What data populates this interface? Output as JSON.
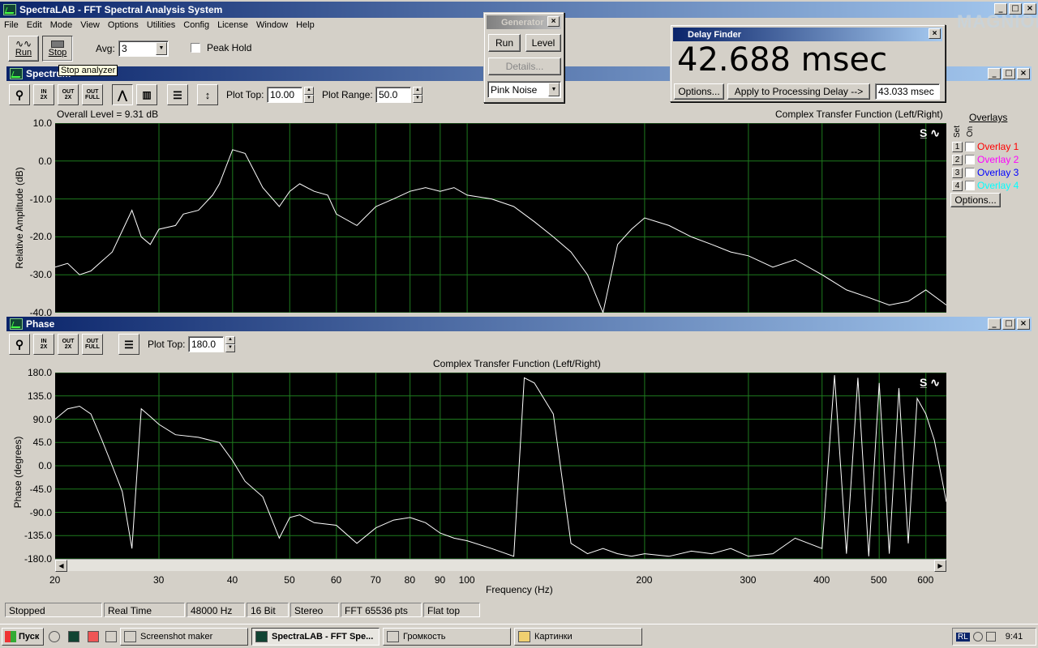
{
  "app": {
    "title": "SpectraLAB - FFT Spectral Analysis System",
    "menu": [
      "File",
      "Edit",
      "Mode",
      "View",
      "Options",
      "Utilities",
      "Config",
      "License",
      "Window",
      "Help"
    ]
  },
  "toolbar": {
    "run_label": "Run",
    "stop_label": "Stop",
    "avg_label": "Avg:",
    "avg_value": "3",
    "peak_hold_label": "Peak Hold",
    "tooltip": "Stop analyzer"
  },
  "spectrum": {
    "title": "Spectrum",
    "plot_top_label": "Plot Top:",
    "plot_top_value": "10.00",
    "plot_range_label": "Plot Range:",
    "plot_range_value": "50.0",
    "overall_level": "Overall Level = 9.31 dB",
    "chart_title": "Complex Transfer Function (Left/Right)",
    "ylabel": "Relative Amplitude (dB)",
    "yticks": [
      "10.0",
      "0.0",
      "-10.0",
      "-20.0",
      "-30.0",
      "-40.0"
    ]
  },
  "overlays": {
    "header": "Overlays",
    "set_label": "Set",
    "on_label": "On",
    "items": [
      {
        "num": "1",
        "label": "Overlay 1",
        "color": "#ff0000"
      },
      {
        "num": "2",
        "label": "Overlay 2",
        "color": "#ff00ff"
      },
      {
        "num": "3",
        "label": "Overlay 3",
        "color": "#0000ff"
      },
      {
        "num": "4",
        "label": "Overlay 4",
        "color": "#00ffff"
      }
    ],
    "options_label": "Options..."
  },
  "phase": {
    "title": "Phase",
    "plot_top_label": "Plot Top:",
    "plot_top_value": "180.0",
    "chart_title": "Complex Transfer Function (Left/Right)",
    "ylabel": "Phase (degrees)",
    "yticks": [
      "180.0",
      "135.0",
      "90.0",
      "45.0",
      "0.0",
      "-45.0",
      "-90.0",
      "-135.0",
      "-180.0"
    ],
    "xticks": [
      "20",
      "30",
      "40",
      "50",
      "60",
      "70",
      "80",
      "90",
      "100",
      "200",
      "300",
      "400",
      "500",
      "600"
    ],
    "xlabel": "Frequency (Hz)"
  },
  "generator": {
    "title": "Generator",
    "run_label": "Run",
    "level_label": "Level",
    "details_label": "Details...",
    "signal": "Pink Noise"
  },
  "delay_finder": {
    "title": "Delay Finder",
    "value": "42.688 msec",
    "options_label": "Options...",
    "apply_label": "Apply to Processing Delay -->",
    "processing_delay": "43.033 msec"
  },
  "status": [
    "Stopped",
    "Real Time",
    "48000 Hz",
    "16 Bit",
    "Stereo",
    "FFT 65536 pts",
    "Flat top"
  ],
  "taskbar": {
    "start": "Пуск",
    "tasks": [
      "Screenshot maker",
      "SpectraLAB - FFT Spe...",
      "Громкость",
      "Картинки"
    ],
    "lang": "RL",
    "clock": "9:41"
  },
  "watermark": "MAGNIOLA",
  "chart_data": [
    {
      "type": "line",
      "title": "Complex Transfer Function (Left/Right)",
      "xlabel": "",
      "ylabel": "Relative Amplitude (dB)",
      "xscale": "log",
      "xlim": [
        20,
        650
      ],
      "ylim": [
        -40,
        10
      ],
      "grid": true,
      "x": [
        20,
        21,
        22,
        23,
        25,
        27,
        28,
        29,
        30,
        32,
        33,
        35,
        37,
        38,
        40,
        42,
        45,
        48,
        50,
        52,
        55,
        58,
        60,
        65,
        70,
        75,
        80,
        85,
        90,
        95,
        100,
        110,
        120,
        130,
        140,
        150,
        160,
        170,
        180,
        190,
        200,
        220,
        240,
        260,
        280,
        300,
        330,
        360,
        400,
        440,
        480,
        520,
        560,
        600,
        650
      ],
      "y": [
        -28,
        -27,
        -30,
        -29,
        -24,
        -13,
        -20,
        -22,
        -18,
        -17,
        -14,
        -13,
        -9,
        -6,
        3,
        2,
        -7,
        -12,
        -8,
        -6,
        -8,
        -9,
        -14,
        -17,
        -12,
        -10,
        -8,
        -7,
        -8,
        -7,
        -9,
        -10,
        -12,
        -16,
        -20,
        -24,
        -30,
        -40,
        -22,
        -18,
        -15,
        -17,
        -20,
        -22,
        -24,
        -25,
        -28,
        -26,
        -30,
        -34,
        -36,
        -38,
        -37,
        -34,
        -38
      ]
    },
    {
      "type": "line",
      "title": "Complex Transfer Function (Left/Right)",
      "xlabel": "Frequency (Hz)",
      "ylabel": "Phase (degrees)",
      "xscale": "log",
      "xlim": [
        20,
        650
      ],
      "ylim": [
        -180,
        180
      ],
      "grid": true,
      "x": [
        20,
        21,
        22,
        23,
        24,
        25,
        26,
        27,
        28,
        29,
        30,
        32,
        35,
        38,
        40,
        42,
        45,
        48,
        50,
        52,
        55,
        60,
        65,
        70,
        75,
        80,
        85,
        90,
        95,
        100,
        110,
        120,
        125,
        130,
        140,
        150,
        160,
        170,
        180,
        190,
        200,
        220,
        240,
        260,
        280,
        300,
        330,
        360,
        400,
        420,
        440,
        460,
        480,
        500,
        520,
        540,
        560,
        580,
        600,
        620,
        650
      ],
      "y": [
        90,
        110,
        115,
        100,
        50,
        0,
        -50,
        -160,
        110,
        95,
        80,
        60,
        55,
        45,
        10,
        -30,
        -60,
        -140,
        -100,
        -95,
        -110,
        -115,
        -150,
        -120,
        -105,
        -100,
        -110,
        -130,
        -140,
        -145,
        -160,
        -175,
        170,
        160,
        100,
        -150,
        -170,
        -160,
        -170,
        -175,
        -170,
        -175,
        -165,
        -170,
        -160,
        -175,
        -170,
        -140,
        -160,
        175,
        -170,
        170,
        -175,
        160,
        -170,
        150,
        -150,
        130,
        100,
        50,
        -70
      ]
    }
  ]
}
